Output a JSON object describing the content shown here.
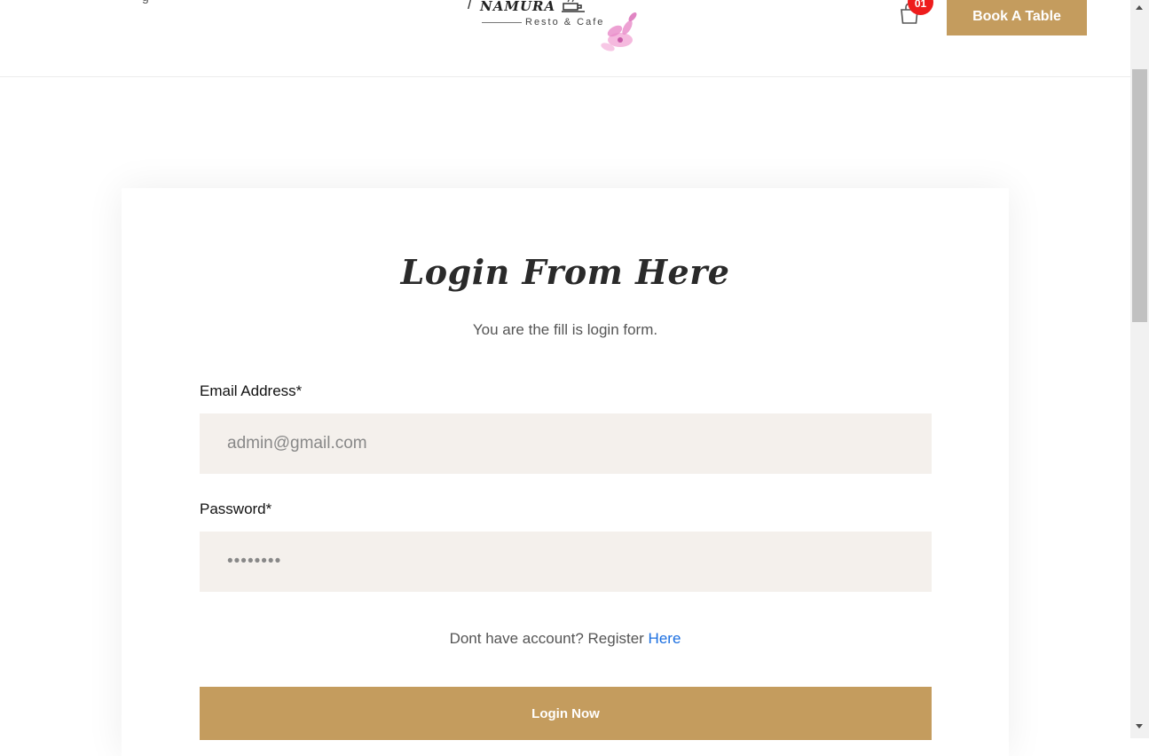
{
  "header": {
    "nav_fragment": "g",
    "logo": {
      "brand": "NAMURA",
      "tagline": "Resto & Cafe"
    },
    "cart_count": "01",
    "book_button": "Book A Table"
  },
  "form": {
    "title": "Login From Here",
    "subtitle": "You are the fill is login form.",
    "email_label": "Email Address*",
    "email_placeholder": "admin@gmail.com",
    "password_label": "Password*",
    "password_value": "••••••••",
    "register_prefix": "Dont have account? Register ",
    "register_link": "Here",
    "submit_label": "Login Now"
  },
  "colors": {
    "accent": "#c49c5e",
    "badge": "#ee1c1c",
    "field_bg": "#f4f0ec",
    "link": "#1a6ee0"
  }
}
